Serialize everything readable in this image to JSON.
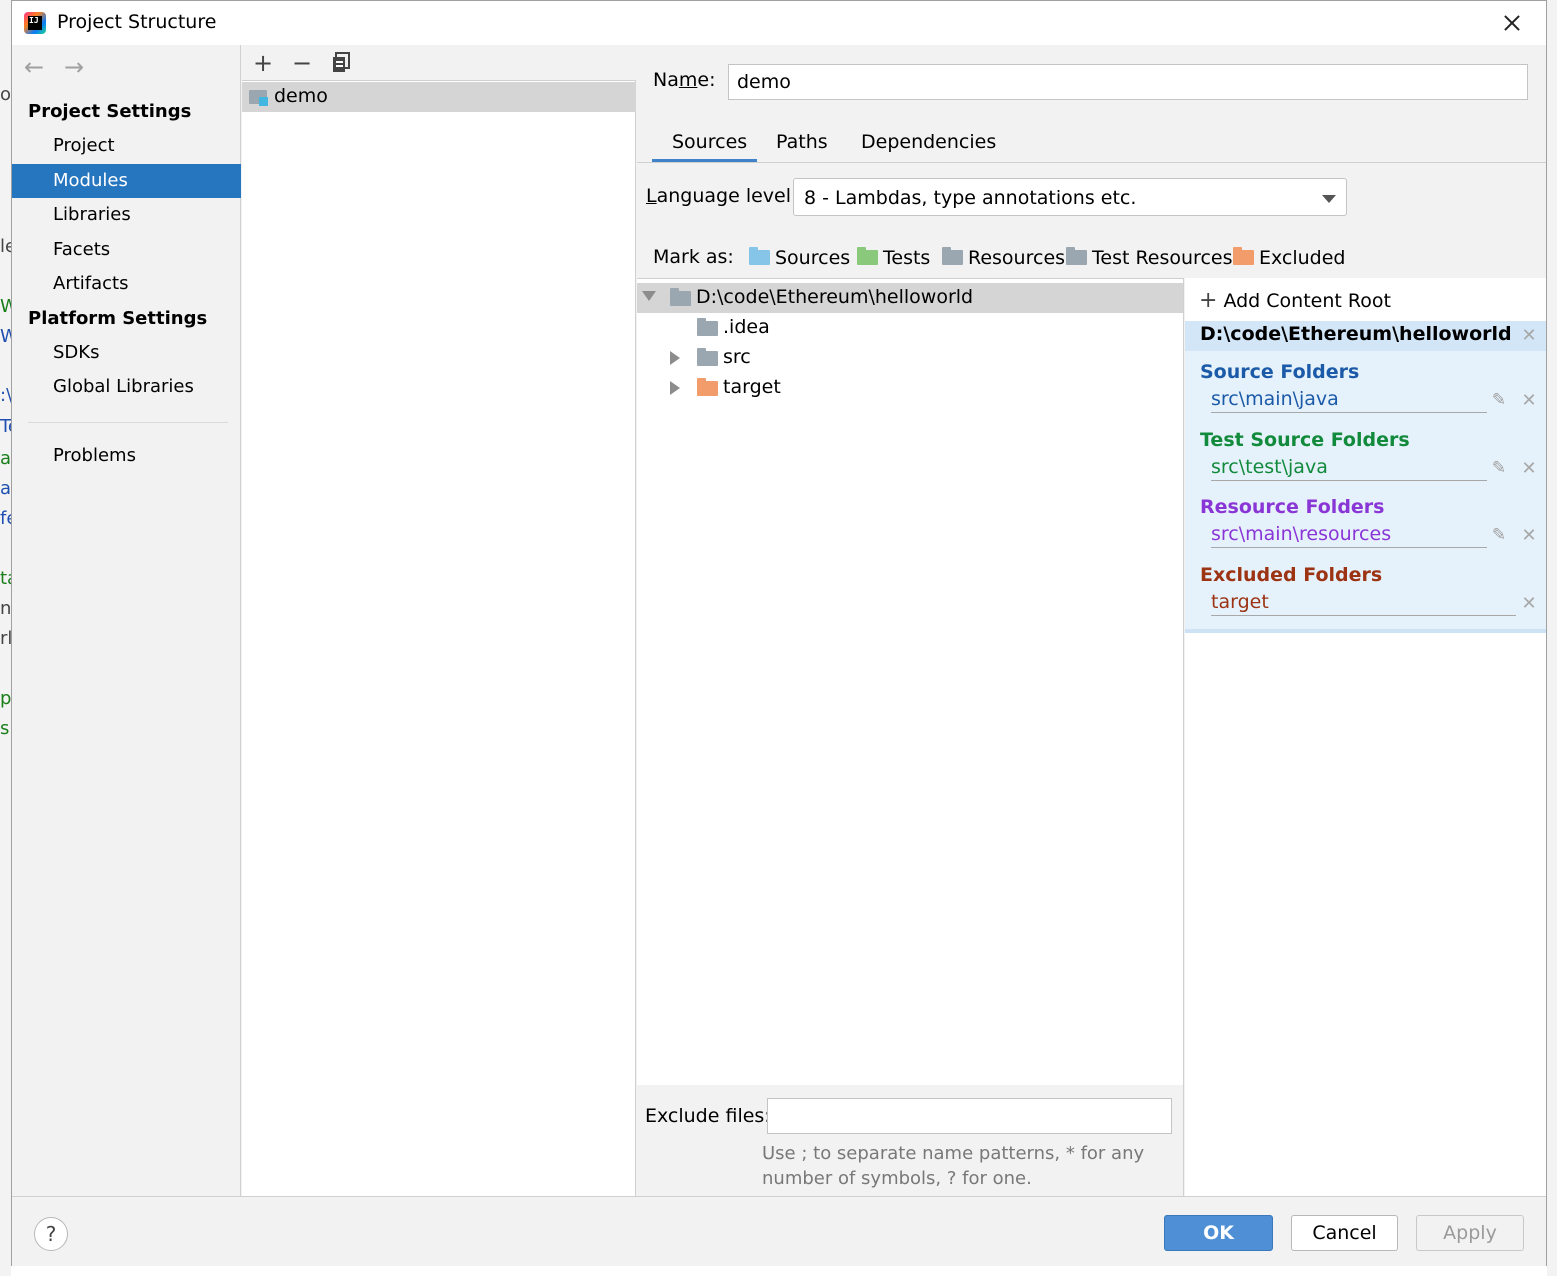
{
  "window": {
    "title": "Project Structure"
  },
  "background_fragments": [
    {
      "text": "oc",
      "color": "#444"
    },
    {
      "text": "le",
      "color": "#444"
    },
    {
      "text": "W",
      "color": "#1a7f1a"
    },
    {
      "text": "W",
      "color": "#1f4fb0"
    },
    {
      "text": ":\\",
      "color": "#1f4fb0"
    },
    {
      "text": "Te",
      "color": "#1f4fb0"
    },
    {
      "text": "a",
      "color": "#1a7f1a"
    },
    {
      "text": "a",
      "color": "#1f4fb0"
    },
    {
      "text": "fe",
      "color": "#1f4fb0"
    },
    {
      "text": "ta",
      "color": "#1a7f1a"
    },
    {
      "text": "nc",
      "color": "#444"
    },
    {
      "text": "rl",
      "color": "#444"
    },
    {
      "text": "p",
      "color": "#1a7f1a"
    },
    {
      "text": "s",
      "color": "#1a7f1a"
    }
  ],
  "nav": {
    "back_icon": "arrow-left-icon",
    "forward_icon": "arrow-right-icon",
    "project_settings_header": "Project Settings",
    "project_settings_items": [
      "Project",
      "Modules",
      "Libraries",
      "Facets",
      "Artifacts"
    ],
    "selected_item": "Modules",
    "platform_settings_header": "Platform Settings",
    "platform_settings_items": [
      "SDKs",
      "Global Libraries"
    ],
    "problems": "Problems"
  },
  "module_list": {
    "toolbar_icons": [
      "plus-icon",
      "minus-icon",
      "copy-icon"
    ],
    "modules": [
      "demo"
    ]
  },
  "module": {
    "name_label": "Name:",
    "name_value": "demo",
    "tabs": [
      "Sources",
      "Paths",
      "Dependencies"
    ],
    "active_tab": "Sources",
    "language_level_label": "Language level:",
    "language_level_value": "8 - Lambdas, type annotations etc.",
    "mark_as_label": "Mark as:",
    "mark_as": [
      {
        "label": "Sources",
        "color": "#87c5e8"
      },
      {
        "label": "Tests",
        "color": "#8ac97b"
      },
      {
        "label": "Resources",
        "color": "#9aa7b0"
      },
      {
        "label": "Test Resources",
        "color": "#9aa7b0"
      },
      {
        "label": "Excluded",
        "color": "#f39c6b"
      }
    ],
    "tree": [
      {
        "label": "D:\\code\\Ethereum\\helloworld",
        "expanded": true,
        "color": "#9aa7b0"
      },
      {
        "label": ".idea",
        "color": "#9aa7b0"
      },
      {
        "label": "src",
        "expanded": false,
        "color": "#9aa7b0"
      },
      {
        "label": "target",
        "expanded": false,
        "color": "#f39c6b"
      }
    ],
    "exclude_files_label": "Exclude files:",
    "exclude_files_value": "",
    "exclude_hint": "Use ; to separate name patterns, * for any number of symbols, ? for one."
  },
  "content_root": {
    "add_label": "Add Content Root",
    "path": "D:\\code\\Ethereum\\helloworld",
    "groups": [
      {
        "title": "Source Folders",
        "path": "src\\main\\java",
        "color": "#1b5aa8",
        "editable": true
      },
      {
        "title": "Test Source Folders",
        "path": "src\\test\\java",
        "color": "#118a3b",
        "editable": true
      },
      {
        "title": "Resource Folders",
        "path": "src\\main\\resources",
        "color": "#8a35d6",
        "editable": true
      },
      {
        "title": "Excluded Folders",
        "path": "target",
        "color": "#9c3313",
        "editable": false
      }
    ]
  },
  "buttons": {
    "help": "?",
    "ok": "OK",
    "cancel": "Cancel",
    "apply": "Apply"
  }
}
